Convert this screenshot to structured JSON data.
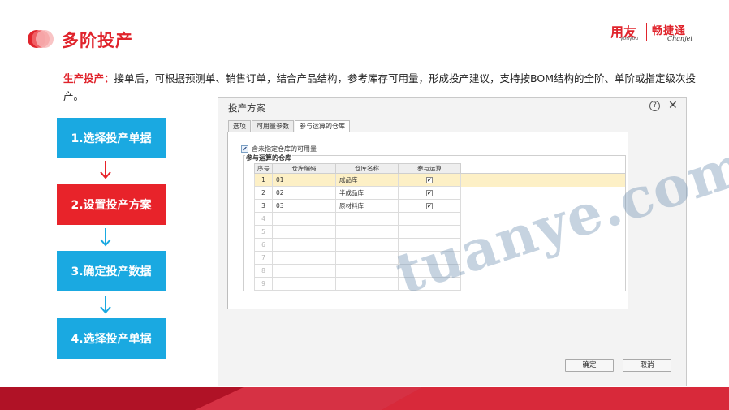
{
  "header": {
    "title": "多阶投产",
    "logo_colors": [
      "#e0242c",
      "#f26a6f",
      "#f7b5b7"
    ]
  },
  "brand": {
    "yonyou": "用友",
    "yonyou_sub": "yonyou",
    "chanjet": "畅捷通",
    "chanjet_sub": "Chanjet",
    "color": "#e0242c"
  },
  "intro": {
    "label": "生产投产：",
    "text": "接单后，可根据预测单、销售订单，结合产品结构，参考库存可用量，形成投产建议，支持按BOM结构的全阶、单阶或指定级次投产。"
  },
  "steps": [
    {
      "label": "1.选择投产单据",
      "color": "#1aa9e1"
    },
    {
      "label": "2.设置投产方案",
      "color": "#e8232a"
    },
    {
      "label": "3.确定投产数据",
      "color": "#1aa9e1"
    },
    {
      "label": "4.选择投产单据",
      "color": "#1aa9e1"
    }
  ],
  "dialog": {
    "title": "投产方案",
    "help_icon": "question-circle-icon",
    "close_icon": "close-icon",
    "tabs": [
      "选项",
      "可用量参数",
      "参与运算的仓库"
    ],
    "active_tab": 2,
    "include_checkbox": {
      "label": "含未指定仓库的可用量",
      "checked": true
    },
    "group_title": "参与运算的仓库",
    "columns": [
      "序号",
      "仓库编码",
      "仓库名称",
      "参与运算"
    ],
    "rows": [
      {
        "no": "1",
        "code": "01",
        "name": "成品库",
        "checked": true
      },
      {
        "no": "2",
        "code": "02",
        "name": "半成品库",
        "checked": true
      },
      {
        "no": "3",
        "code": "03",
        "name": "原材料库",
        "checked": true
      },
      {
        "no": "4",
        "code": "",
        "name": "",
        "checked": false
      },
      {
        "no": "5",
        "code": "",
        "name": "",
        "checked": false
      },
      {
        "no": "6",
        "code": "",
        "name": "",
        "checked": false
      },
      {
        "no": "7",
        "code": "",
        "name": "",
        "checked": false
      },
      {
        "no": "8",
        "code": "",
        "name": "",
        "checked": false
      },
      {
        "no": "9",
        "code": "",
        "name": "",
        "checked": false
      }
    ],
    "ok_label": "确定",
    "cancel_label": "取消"
  },
  "watermark": "tuanye.com"
}
